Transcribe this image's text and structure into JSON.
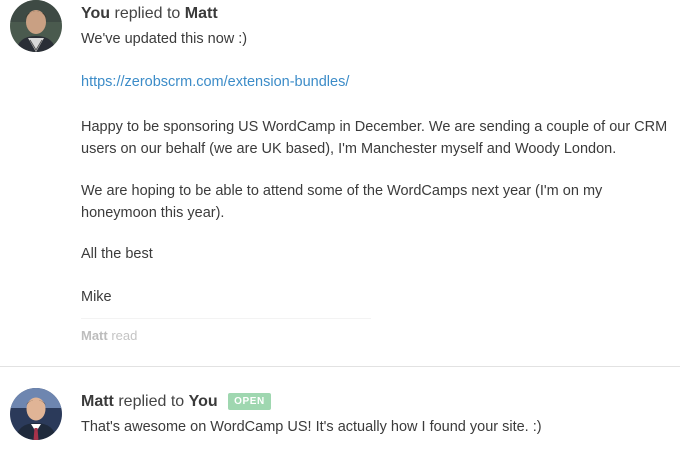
{
  "messages": [
    {
      "author": "You",
      "action": "replied to",
      "recipient": "Matt",
      "avatar": "avatar-you",
      "lines": {
        "greeting": "We've updated this now :)",
        "link": "https://zerobscrm.com/extension-bundles/",
        "p1": "Happy to be sponsoring US WordCamp in December.  We are sending a couple of our CRM users on our behalf (we are UK based), I'm Manchester myself and Woody London.",
        "p2": "We are hoping to be able to attend some of the WordCamps next year (I'm on my honeymoon this year).",
        "p3": "All the best",
        "p4": "Mike"
      },
      "read_receipt": {
        "name": "Matt",
        "label": "read"
      }
    },
    {
      "author": "Matt",
      "action": "replied to",
      "recipient": "You",
      "avatar": "avatar-matt",
      "status_badge": "OPEN",
      "status_color": "#9fd7b0",
      "text": "That's awesome on WordCamp US! It's actually how I found your site. :)"
    }
  ],
  "colors": {
    "link": "#3c8cc8",
    "text": "#3b3b3b",
    "muted": "#c4c4c4"
  }
}
